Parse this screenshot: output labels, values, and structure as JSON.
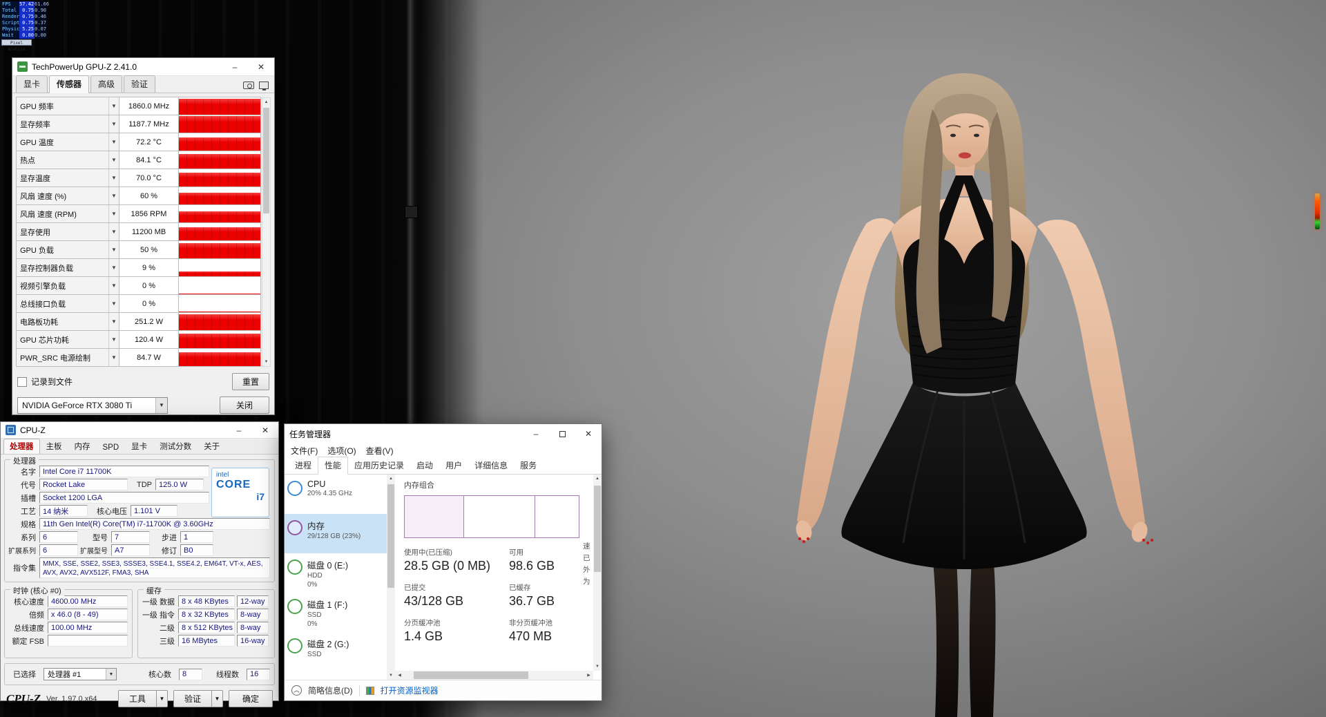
{
  "scene": {
    "backdrop_gray": "#8d8d8d",
    "curtain_black": "#060606",
    "led_top_color": "#ff5a00",
    "led_bottom_color": "#35d435"
  },
  "fps_overlay": {
    "rows": [
      {
        "label": "FPS",
        "v1": "57.42",
        "v2": "61.66"
      },
      {
        "label": "Total",
        "v1": "0.75",
        "v2": "0.90"
      },
      {
        "label": "Render",
        "v1": "0.75",
        "v2": "0.46"
      },
      {
        "label": "Script",
        "v1": "0.75",
        "v2": "0.37"
      },
      {
        "label": "Physics",
        "v1": "5.25",
        "v2": "0.07"
      },
      {
        "label": "Wait",
        "v1": "0.80",
        "v2": "0.00"
      }
    ],
    "button_label": "Pixel Analyze"
  },
  "gpuz": {
    "title": "TechPowerUp GPU-Z 2.41.0",
    "tabs": [
      {
        "label": "显卡"
      },
      {
        "label": "传感器"
      },
      {
        "label": "高级"
      },
      {
        "label": "验证"
      }
    ],
    "bar_color": "#ec0000",
    "sensors": [
      {
        "label": "GPU 频率",
        "value": "1860.0 MHz",
        "bar_pct": 93
      },
      {
        "label": "显存频率",
        "value": "1187.7 MHz",
        "bar_pct": 95
      },
      {
        "label": "GPU 温度",
        "value": "72.2 °C",
        "bar_pct": 78
      },
      {
        "label": "热点",
        "value": "84.1 °C",
        "bar_pct": 84
      },
      {
        "label": "显存温度",
        "value": "70.0 °C",
        "bar_pct": 80
      },
      {
        "label": "风扇 速度 (%)",
        "value": "60 %",
        "bar_pct": 68
      },
      {
        "label": "风扇 速度 (RPM)",
        "value": "1856 RPM",
        "bar_pct": 66
      },
      {
        "label": "显存使用",
        "value": "11200 MB",
        "bar_pct": 76
      },
      {
        "label": "GPU 负载",
        "value": "50 %",
        "bar_pct": 90
      },
      {
        "label": "显存控制器负载",
        "value": "9 %",
        "bar_pct": 28
      },
      {
        "label": "视频引擎负载",
        "value": "0 %",
        "bar_pct": 4
      },
      {
        "label": "总线接口负载",
        "value": "0 %",
        "bar_pct": 4
      },
      {
        "label": "电路板功耗",
        "value": "251.2 W",
        "bar_pct": 92
      },
      {
        "label": "GPU 芯片功耗",
        "value": "120.4 W",
        "bar_pct": 86
      },
      {
        "label": "PWR_SRC 电源绘制",
        "value": "84.7 W",
        "bar_pct": 82
      }
    ],
    "log_checkbox_label": "记录到文件",
    "reset_button": "重置",
    "device_select": "NVIDIA GeForce RTX 3080 Ti",
    "close_button": "关闭"
  },
  "cpuz": {
    "title": "CPU-Z",
    "tabs": [
      {
        "label": "处理器"
      },
      {
        "label": "主板"
      },
      {
        "label": "内存"
      },
      {
        "label": "SPD"
      },
      {
        "label": "显卡"
      },
      {
        "label": "测试分数"
      },
      {
        "label": "关于"
      }
    ],
    "processor": {
      "group_label": "处理器",
      "name_label": "名字",
      "name": "Intel Core i7 11700K",
      "codename_label": "代号",
      "codename": "Rocket Lake",
      "tdp_label": "TDP",
      "tdp": "125.0 W",
      "package_label": "插槽",
      "package": "Socket 1200 LGA",
      "tech_label": "工艺",
      "tech": "14 纳米",
      "voltage_label": "核心电压",
      "voltage": "1.101 V",
      "spec_label": "规格",
      "spec": "11th Gen Intel(R) Core(TM) i7-11700K @ 3.60GHz",
      "family_label": "系列",
      "family": "6",
      "model_label": "型号",
      "model": "7",
      "stepping_label": "步进",
      "stepping": "1",
      "ext_family_label": "扩展系列",
      "ext_family": "6",
      "ext_model_label": "扩展型号",
      "ext_model": "A7",
      "revision_label": "修订",
      "revision": "B0",
      "instructions_label": "指令集",
      "instructions": "MMX, SSE, SSE2, SSE3, SSSE3, SSE4.1, SSE4.2, EM64T, VT-x, AES, AVX, AVX2, AVX512F, FMA3, SHA",
      "badge_line1": "intel",
      "badge_line2": "CORE",
      "badge_line3": "i7"
    },
    "clocks": {
      "group_label": "时钟 (核心 #0)",
      "core_speed_label": "核心速度",
      "core_speed": "4600.00 MHz",
      "multiplier_label": "倍频",
      "multiplier": "x 46.0 (8 - 49)",
      "bus_speed_label": "总线速度",
      "bus_speed": "100.00 MHz",
      "rated_fsb_label": "额定 FSB",
      "rated_fsb": ""
    },
    "cache": {
      "group_label": "缓存",
      "rows": [
        {
          "label": "一级 数据",
          "size": "8 x 48 KBytes",
          "assoc": "12-way"
        },
        {
          "label": "一级 指令",
          "size": "8 x 32 KBytes",
          "assoc": "8-way"
        },
        {
          "label": "二级",
          "size": "8 x 512 KBytes",
          "assoc": "8-way"
        },
        {
          "label": "三级",
          "size": "16 MBytes",
          "assoc": "16-way"
        }
      ]
    },
    "selection": {
      "label": "已选择",
      "value": "处理器 #1",
      "cores_label": "核心数",
      "cores": "8",
      "threads_label": "线程数",
      "threads": "16"
    },
    "footer": {
      "brand": "CPU-Z",
      "version": "Ver. 1.97.0.x64",
      "tools_button": "工具",
      "validate_button": "验证",
      "ok_button": "确定"
    }
  },
  "taskmgr": {
    "title": "任务管理器",
    "menu": [
      {
        "label": "文件(F)"
      },
      {
        "label": "选项(O)"
      },
      {
        "label": "查看(V)"
      }
    ],
    "tabs": [
      {
        "label": "进程"
      },
      {
        "label": "性能"
      },
      {
        "label": "应用历史记录"
      },
      {
        "label": "启动"
      },
      {
        "label": "用户"
      },
      {
        "label": "详细信息"
      },
      {
        "label": "服务"
      }
    ],
    "sidebar": [
      {
        "name": "CPU",
        "line1": "20% 4.35 GHz",
        "line2": "",
        "ring_color": "#3f8ad1"
      },
      {
        "name": "内存",
        "line1": "29/128 GB (23%)",
        "line2": "",
        "ring_color": "#9253a1"
      },
      {
        "name": "磁盘 0 (E:)",
        "line1": "HDD",
        "line2": "0%",
        "ring_color": "#4ba34e"
      },
      {
        "name": "磁盘 1 (F:)",
        "line1": "SSD",
        "line2": "0%",
        "ring_color": "#4ba34e"
      },
      {
        "name": "磁盘 2 (G:)",
        "line1": "SSD",
        "line2": "",
        "ring_color": "#4ba34e"
      }
    ],
    "memory_panel": {
      "section_label": "内存组合",
      "accent_color": "#9253a1",
      "stats": [
        {
          "label": "使用中(已压缩)",
          "value": "28.5 GB (0 MB)"
        },
        {
          "label": "可用",
          "value": "98.6 GB"
        },
        {
          "label": "已提交",
          "value": "43/128 GB"
        },
        {
          "label": "已缓存",
          "value": "36.7 GB"
        },
        {
          "label": "分页缓冲池",
          "value": "1.4 GB"
        },
        {
          "label": "非分页缓冲池",
          "value": "470 MB"
        }
      ],
      "truncated_labels": [
        "速",
        "已",
        "外",
        "为"
      ]
    },
    "footer": {
      "less_details": "简略信息(D)",
      "open_resource_monitor": "打开资源监视器"
    }
  }
}
